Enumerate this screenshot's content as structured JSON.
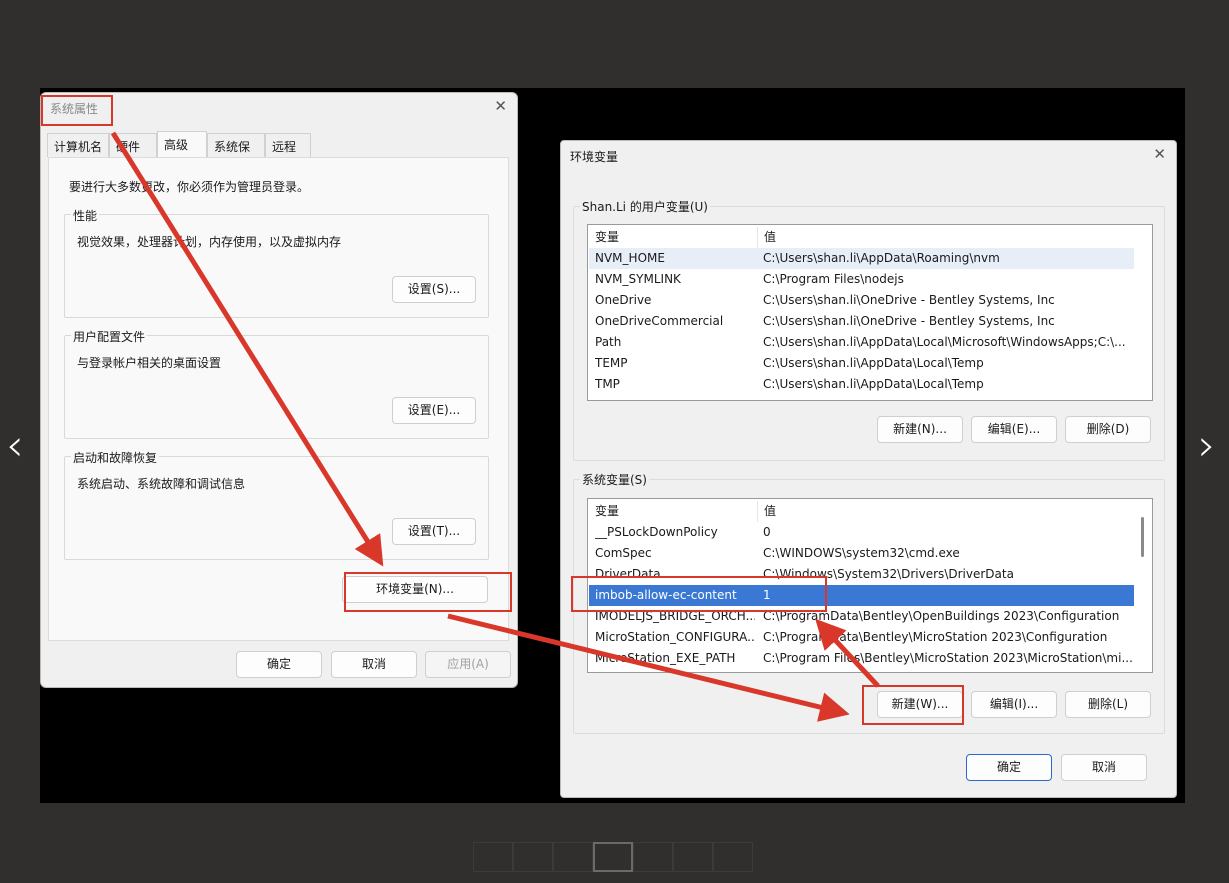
{
  "sys_props": {
    "title": "系统属性",
    "tabs": [
      "计算机名",
      "硬件",
      "高级",
      "系统保护",
      "远程"
    ],
    "admin_note": "要进行大多数更改，你必须作为管理员登录。",
    "groups": [
      {
        "label": "性能",
        "text": "视觉效果，处理器计划，内存使用，以及虚拟内存",
        "button": "设置(S)..."
      },
      {
        "label": "用户配置文件",
        "text": "与登录帐户相关的桌面设置",
        "button": "设置(E)..."
      },
      {
        "label": "启动和故障恢复",
        "text": "系统启动、系统故障和调试信息",
        "button": "设置(T)..."
      }
    ],
    "env_button": "环境变量(N)...",
    "ok": "确定",
    "cancel": "取消",
    "apply": "应用(A)"
  },
  "env_vars": {
    "title": "环境变量",
    "user_section": "Shan.Li 的用户变量(U)",
    "columns": [
      "变量",
      "值"
    ],
    "user_rows": [
      [
        "NVM_HOME",
        "C:\\Users\\shan.li\\AppData\\Roaming\\nvm"
      ],
      [
        "NVM_SYMLINK",
        "C:\\Program Files\\nodejs"
      ],
      [
        "OneDrive",
        "C:\\Users\\shan.li\\OneDrive - Bentley Systems, Inc"
      ],
      [
        "OneDriveCommercial",
        "C:\\Users\\shan.li\\OneDrive - Bentley Systems, Inc"
      ],
      [
        "Path",
        "C:\\Users\\shan.li\\AppData\\Local\\Microsoft\\WindowsApps;C:\\..."
      ],
      [
        "TEMP",
        "C:\\Users\\shan.li\\AppData\\Local\\Temp"
      ],
      [
        "TMP",
        "C:\\Users\\shan.li\\AppData\\Local\\Temp"
      ]
    ],
    "user_buttons": [
      "新建(N)...",
      "编辑(E)...",
      "删除(D)"
    ],
    "sys_section": "系统变量(S)",
    "sys_rows": [
      [
        "__PSLockDownPolicy",
        "0"
      ],
      [
        "ComSpec",
        "C:\\WINDOWS\\system32\\cmd.exe"
      ],
      [
        "DriverData",
        "C:\\Windows\\System32\\Drivers\\DriverData"
      ],
      [
        "imbob-allow-ec-content",
        "1"
      ],
      [
        "IMODELJS_BRIDGE_ORCH...",
        "C:\\ProgramData\\Bentley\\OpenBuildings 2023\\Configuration"
      ],
      [
        "MicroStation_CONFIGURA...",
        "C:\\ProgramData\\Bentley\\MicroStation 2023\\Configuration"
      ],
      [
        "MicroStation_EXE_PATH",
        "C:\\Program Files\\Bentley\\MicroStation 2023\\MicroStation\\mi..."
      ]
    ],
    "sys_buttons": [
      "新建(W)...",
      "编辑(I)...",
      "删除(L)"
    ],
    "ok": "确定",
    "cancel": "取消"
  },
  "viewer": {
    "prev": "‹",
    "next": "›",
    "current_thumb": 4,
    "thumb_count": 7
  },
  "colors": {
    "annotation": "#d8372a",
    "selection": "#3a78d4"
  }
}
